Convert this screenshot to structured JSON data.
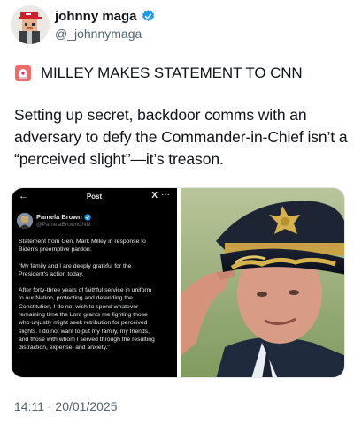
{
  "author": {
    "display_name": "johnny maga",
    "handle": "@_johnnymaga",
    "avatar_icon": "pixel-avatar-red-cap",
    "verified_icon": "verified-badge-icon"
  },
  "post": {
    "headline_icon": "siren-icon",
    "headline": "MILLEY MAKES STATEMENT TO CNN",
    "body_lines": [
      "Setting up secret, backdoor comms with an",
      "adversary to defy the Commander-in-Chief isn’t a",
      "“perceived slight”—it’s treason."
    ],
    "timestamp": "14:11 · 20/01/2025"
  },
  "media": {
    "screenshot": {
      "back_icon": "←",
      "title": "Post",
      "x_logo": "X",
      "more_icon": "···",
      "author_name": "Pamela Brown",
      "author_handle": "@PamelaBrownCNN",
      "paragraphs": [
        [
          "Statement from Gen. Mark Milley in response to",
          "Biden's preemptive pardon:"
        ],
        [
          "\"My family and I are deeply grateful for the",
          "President's action today."
        ],
        [
          "After forty-three years of faithful service in uniform",
          "to our Nation, protecting and defending the",
          "Constitution, I do not wish to spend whatever",
          "remaining time the Lord grants me fighting those",
          "who unjustly might seek retribution for perceived",
          "slights.  I do not want to put my family, my friends,",
          "and those with whom I served through the resulting",
          "distraction, expense, and anxiety.\""
        ]
      ]
    },
    "photo": {
      "subject": "general-in-uniform-saluting"
    }
  },
  "colors": {
    "text": "#0f1419",
    "muted": "#536471",
    "verified": "#1d9bf0",
    "siren_red": "#e0245e"
  }
}
